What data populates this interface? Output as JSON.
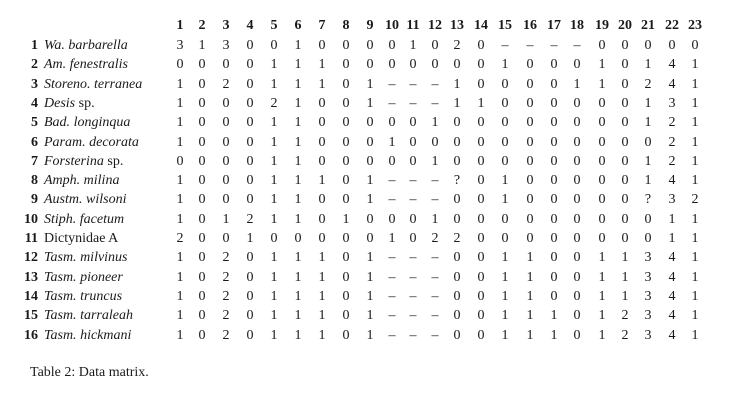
{
  "table": {
    "columns": [
      "1",
      "2",
      "3",
      "4",
      "5",
      "6",
      "7",
      "8",
      "9",
      "10",
      "11",
      "12",
      "13",
      "14",
      "15",
      "16",
      "17",
      "18",
      "19",
      "20",
      "21",
      "22",
      "23"
    ],
    "rows": [
      {
        "num": "1",
        "genus": "Wa.",
        "species": "barbarella",
        "values": [
          "3",
          "1",
          "3",
          "0",
          "0",
          "1",
          "0",
          "0",
          "0",
          "0",
          "1",
          "0",
          "2",
          "0",
          "–",
          "–",
          "–",
          "–",
          "0",
          "0",
          "0",
          "0",
          "0"
        ]
      },
      {
        "num": "2",
        "genus": "Am.",
        "species": "fenestralis",
        "values": [
          "0",
          "0",
          "0",
          "0",
          "1",
          "1",
          "1",
          "0",
          "0",
          "0",
          "0",
          "0",
          "0",
          "0",
          "1",
          "0",
          "0",
          "0",
          "1",
          "0",
          "1",
          "4",
          "1"
        ]
      },
      {
        "num": "3",
        "genus": "Storeno.",
        "species": "terranea",
        "values": [
          "1",
          "0",
          "2",
          "0",
          "1",
          "1",
          "1",
          "0",
          "1",
          "–",
          "–",
          "–",
          "1",
          "0",
          "0",
          "0",
          "0",
          "1",
          "1",
          "0",
          "2",
          "4",
          "1"
        ]
      },
      {
        "num": "4",
        "genus": "Desis",
        "species": "sp.",
        "italicSpecies": false,
        "values": [
          "1",
          "0",
          "0",
          "0",
          "2",
          "1",
          "0",
          "0",
          "1",
          "–",
          "–",
          "–",
          "1",
          "1",
          "0",
          "0",
          "0",
          "0",
          "0",
          "0",
          "1",
          "3",
          "1"
        ]
      },
      {
        "num": "5",
        "genus": "Bad.",
        "species": "longinqua",
        "values": [
          "1",
          "0",
          "0",
          "0",
          "1",
          "1",
          "0",
          "0",
          "0",
          "0",
          "0",
          "1",
          "0",
          "0",
          "0",
          "0",
          "0",
          "0",
          "0",
          "0",
          "1",
          "2",
          "1"
        ]
      },
      {
        "num": "6",
        "genus": "Param.",
        "species": "decorata",
        "values": [
          "1",
          "0",
          "0",
          "0",
          "1",
          "1",
          "0",
          "0",
          "0",
          "1",
          "0",
          "0",
          "0",
          "0",
          "0",
          "0",
          "0",
          "0",
          "0",
          "0",
          "0",
          "2",
          "1"
        ]
      },
      {
        "num": "7",
        "genus": "Forsterina",
        "species": "sp.",
        "italicSpecies": false,
        "values": [
          "0",
          "0",
          "0",
          "0",
          "1",
          "1",
          "0",
          "0",
          "0",
          "0",
          "0",
          "1",
          "0",
          "0",
          "0",
          "0",
          "0",
          "0",
          "0",
          "0",
          "1",
          "2",
          "1"
        ]
      },
      {
        "num": "8",
        "genus": "Amph.",
        "species": "milina",
        "values": [
          "1",
          "0",
          "0",
          "0",
          "1",
          "1",
          "1",
          "0",
          "1",
          "–",
          "–",
          "–",
          "?",
          "0",
          "1",
          "0",
          "0",
          "0",
          "0",
          "0",
          "1",
          "4",
          "1"
        ]
      },
      {
        "num": "9",
        "genus": "Austm.",
        "species": "wilsoni",
        "values": [
          "1",
          "0",
          "0",
          "0",
          "1",
          "1",
          "0",
          "0",
          "1",
          "–",
          "–",
          "–",
          "0",
          "0",
          "1",
          "0",
          "0",
          "0",
          "0",
          "0",
          "?",
          "3",
          "2"
        ]
      },
      {
        "num": "10",
        "genus": "Stiph.",
        "species": "facetum",
        "values": [
          "1",
          "0",
          "1",
          "2",
          "1",
          "1",
          "0",
          "1",
          "0",
          "0",
          "0",
          "1",
          "0",
          "0",
          "0",
          "0",
          "0",
          "0",
          "0",
          "0",
          "0",
          "1",
          "1"
        ]
      },
      {
        "num": "11",
        "genus": "Dictynidae A",
        "species": "",
        "italicGenus": false,
        "values": [
          "2",
          "0",
          "0",
          "1",
          "0",
          "0",
          "0",
          "0",
          "0",
          "1",
          "0",
          "2",
          "2",
          "0",
          "0",
          "0",
          "0",
          "0",
          "0",
          "0",
          "0",
          "1",
          "1"
        ]
      },
      {
        "num": "12",
        "genus": "Tasm.",
        "species": "milvinus",
        "values": [
          "1",
          "0",
          "2",
          "0",
          "1",
          "1",
          "1",
          "0",
          "1",
          "–",
          "–",
          "–",
          "0",
          "0",
          "1",
          "1",
          "0",
          "0",
          "1",
          "1",
          "3",
          "4",
          "1"
        ]
      },
      {
        "num": "13",
        "genus": "Tasm.",
        "species": "pioneer",
        "values": [
          "1",
          "0",
          "2",
          "0",
          "1",
          "1",
          "1",
          "0",
          "1",
          "–",
          "–",
          "–",
          "0",
          "0",
          "1",
          "1",
          "0",
          "0",
          "1",
          "1",
          "3",
          "4",
          "1"
        ]
      },
      {
        "num": "14",
        "genus": "Tasm.",
        "species": "truncus",
        "values": [
          "1",
          "0",
          "2",
          "0",
          "1",
          "1",
          "1",
          "0",
          "1",
          "–",
          "–",
          "–",
          "0",
          "0",
          "1",
          "1",
          "0",
          "0",
          "1",
          "1",
          "3",
          "4",
          "1"
        ]
      },
      {
        "num": "15",
        "genus": "Tasm.",
        "species": "tarraleah",
        "values": [
          "1",
          "0",
          "2",
          "0",
          "1",
          "1",
          "1",
          "0",
          "1",
          "–",
          "–",
          "–",
          "0",
          "0",
          "1",
          "1",
          "1",
          "0",
          "1",
          "2",
          "3",
          "4",
          "1"
        ]
      },
      {
        "num": "16",
        "genus": "Tasm.",
        "species": "hickmani",
        "values": [
          "1",
          "0",
          "2",
          "0",
          "1",
          "1",
          "1",
          "0",
          "1",
          "–",
          "–",
          "–",
          "0",
          "0",
          "1",
          "1",
          "1",
          "0",
          "1",
          "2",
          "3",
          "4",
          "1"
        ]
      }
    ]
  },
  "caption": "Table 2: Data matrix."
}
